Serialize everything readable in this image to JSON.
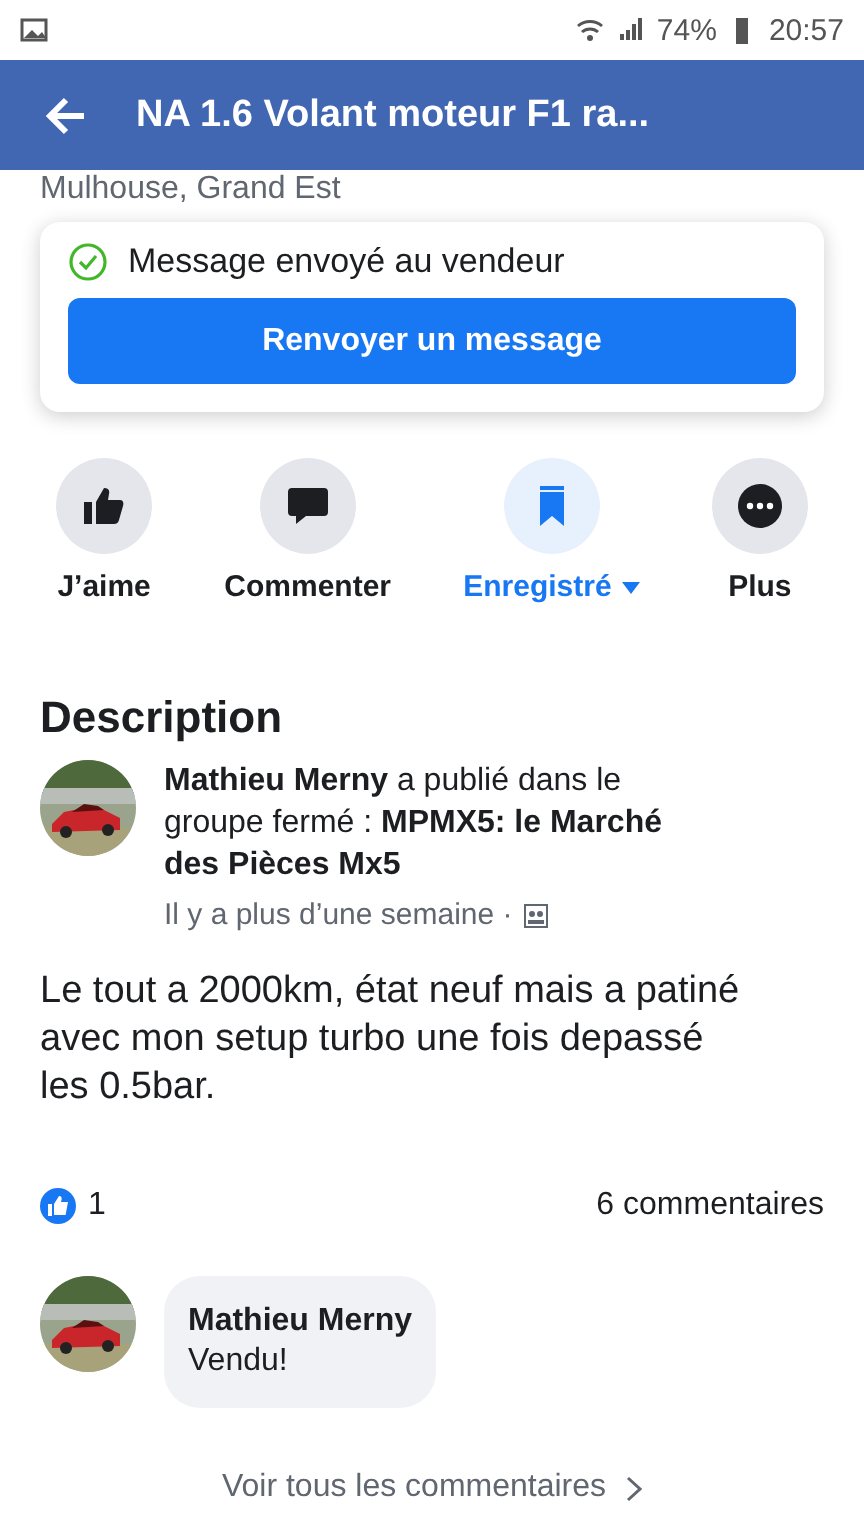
{
  "status_bar": {
    "battery": "74%",
    "time": "20:57"
  },
  "app_bar": {
    "title": "NA 1.6 Volant moteur F1 ra..."
  },
  "location": "Mulhouse, Grand Est",
  "message_card": {
    "status": "Message envoyé au vendeur",
    "button": "Renvoyer un message"
  },
  "actions": [
    {
      "kind": "like",
      "label": "J’aime",
      "selected": false,
      "dropdown": false
    },
    {
      "kind": "comment",
      "label": "Commenter",
      "selected": false,
      "dropdown": false
    },
    {
      "kind": "save",
      "label": "Enregistré",
      "selected": true,
      "dropdown": true
    },
    {
      "kind": "more",
      "label": "Plus",
      "selected": false,
      "dropdown": false
    }
  ],
  "description": {
    "heading": "Description",
    "post_header": "**Mathieu Merny** a publié dans le groupe fermé : **MPMX5: le Marché des Pièces Mx5**",
    "time": "Il y a plus d’une semaine ·",
    "body": "Le tout a 2000km, état neuf mais a patiné avec mon setup turbo une fois depassé les 0.5bar."
  },
  "reactions": {
    "likes": "1",
    "comments": "6 commentaires"
  },
  "comment": {
    "author": "Mathieu Merny",
    "text": "Vendu!"
  },
  "see_all": "Voir tous les commentaires"
}
